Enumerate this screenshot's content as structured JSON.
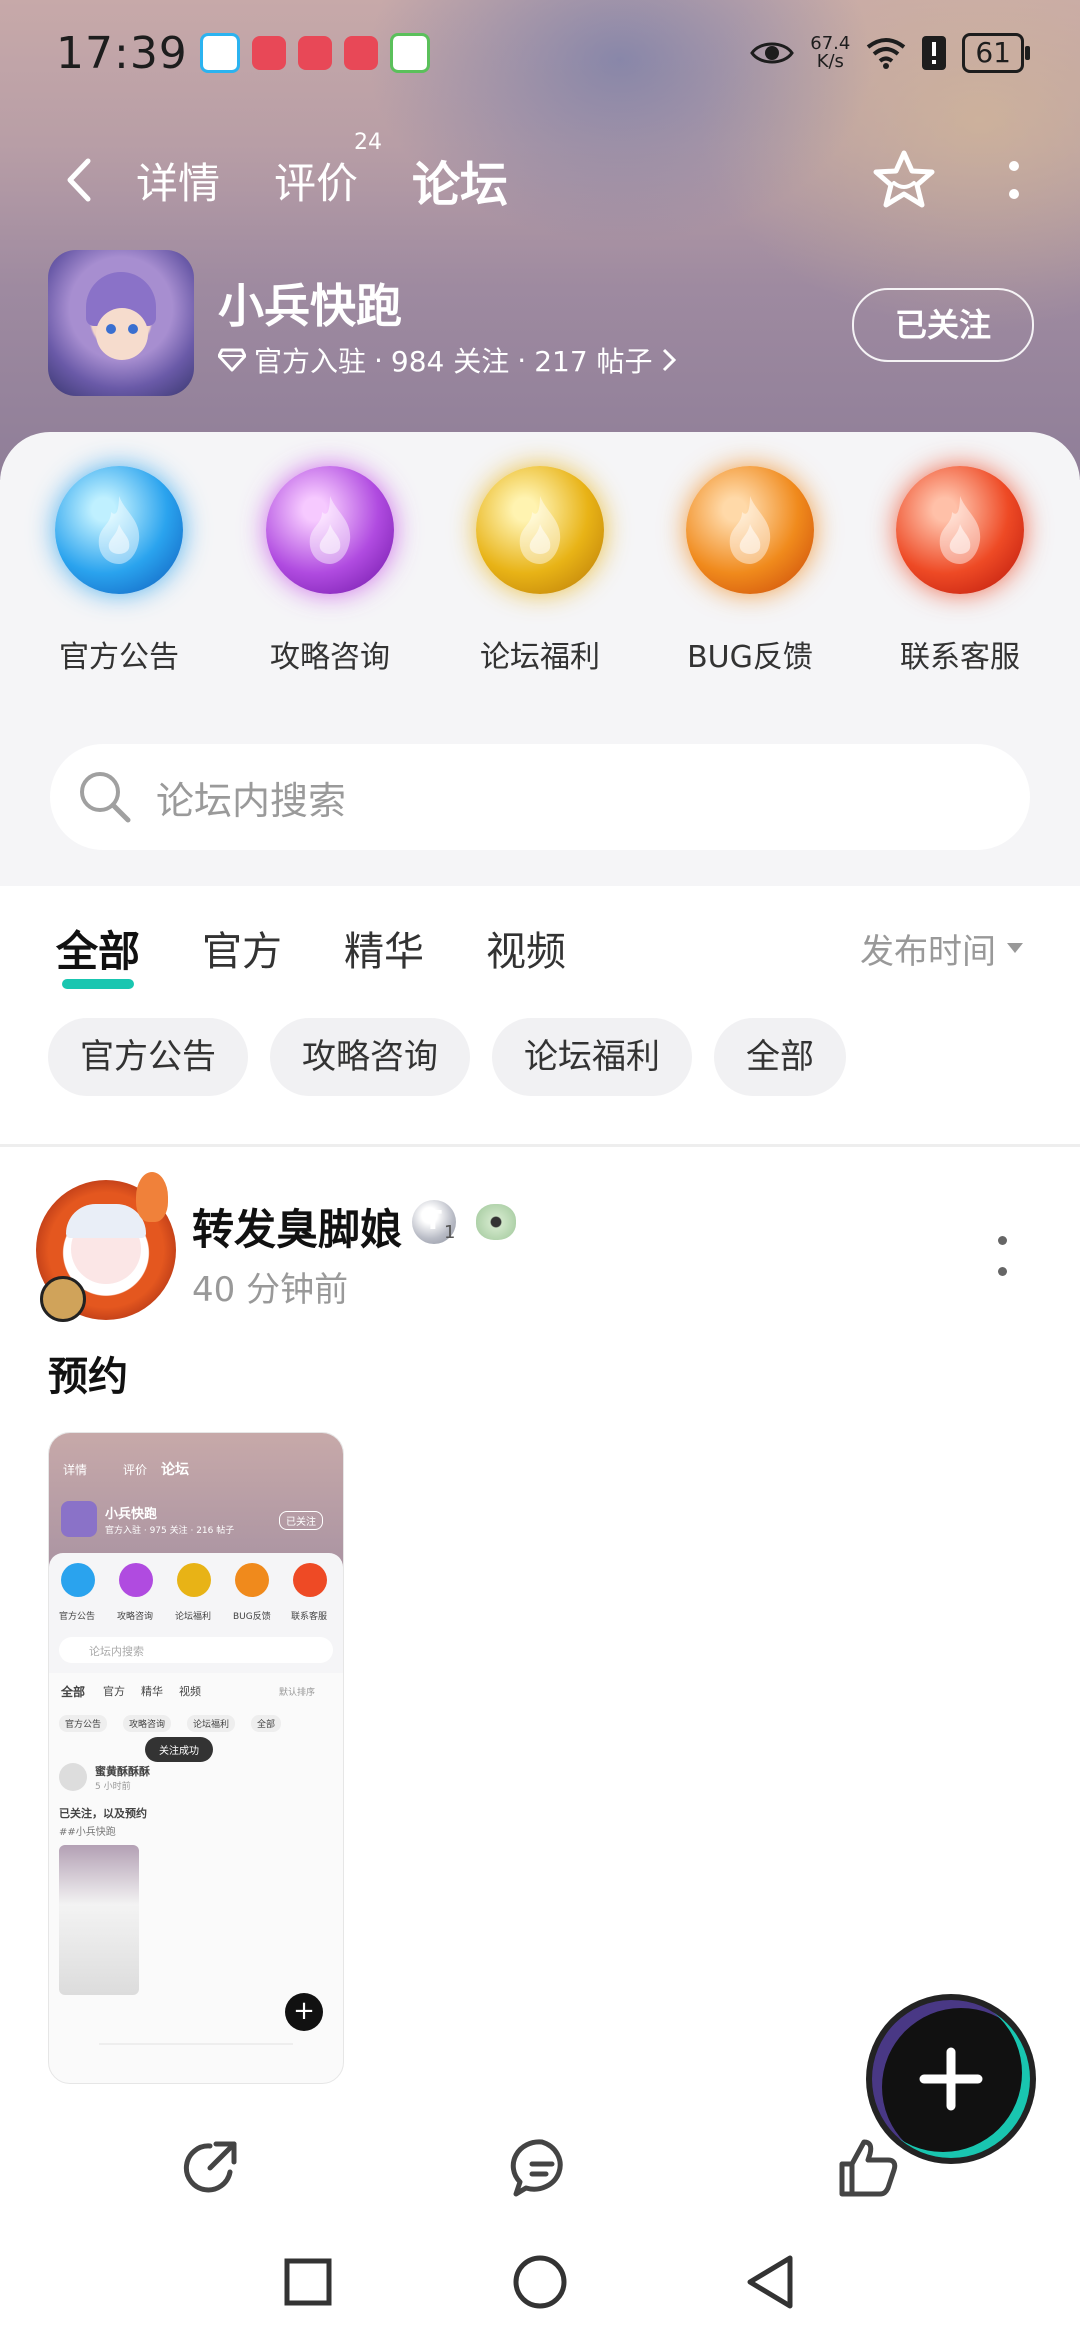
{
  "status_bar": {
    "time": "17:39",
    "network_speed_value": "67.4",
    "network_speed_unit": "K/s",
    "battery": "61",
    "colors": [
      "#2bb3f0",
      "#e84857",
      "#e84857",
      "#e84857",
      "#5bc05b"
    ]
  },
  "nav": {
    "tabs": [
      {
        "label": "详情"
      },
      {
        "label": "评价",
        "badge": "24"
      },
      {
        "label": "论坛"
      }
    ],
    "active_tab": "论坛"
  },
  "game": {
    "name": "小兵快跑",
    "official_label": "官方入驻",
    "sep": "·",
    "followers": "984 关注",
    "posts": "217 帖子",
    "follow_button": "已关注"
  },
  "categories": [
    {
      "label": "官方公告",
      "color": "#2aa3ee"
    },
    {
      "label": "攻略咨询",
      "color": "#b04be0"
    },
    {
      "label": "论坛福利",
      "color": "#e8b316"
    },
    {
      "label": "BUG反馈",
      "color": "#f08a1c"
    },
    {
      "label": "联系客服",
      "color": "#ee4a25"
    }
  ],
  "search": {
    "placeholder": "论坛内搜索"
  },
  "feed_tabs": [
    "全部",
    "官方",
    "精华",
    "视频"
  ],
  "sort_label": "发布时间",
  "chips": [
    "官方公告",
    "攻略咨询",
    "论坛福利",
    "全部"
  ],
  "post": {
    "author": "转发臭脚娘",
    "time": "40 分钟前",
    "title": "预约",
    "badge_level": "1",
    "thumb": {
      "title": "论坛",
      "tabs": [
        "详情",
        "评价",
        "论坛"
      ],
      "game_name": "小兵快跑",
      "follow": "已关注",
      "meta": "官方入驻 · 975 关注 · 216 帖子",
      "cats": [
        "官方公告",
        "攻略咨询",
        "论坛福利",
        "BUG反馈",
        "联系客服"
      ],
      "search": "论坛内搜索",
      "feed_tabs": [
        "全部",
        "官方",
        "精华",
        "视频"
      ],
      "sort": "默认排序",
      "chips": [
        "官方公告",
        "攻略咨询",
        "论坛福利",
        "全部"
      ],
      "toast": "关注成功",
      "post_author": "蜜黄酥酥酥",
      "post_time": "5 小时前",
      "post_title": "已关注，以及预约",
      "post_tag": "##小兵快跑"
    }
  },
  "accent": "#19c6b0"
}
